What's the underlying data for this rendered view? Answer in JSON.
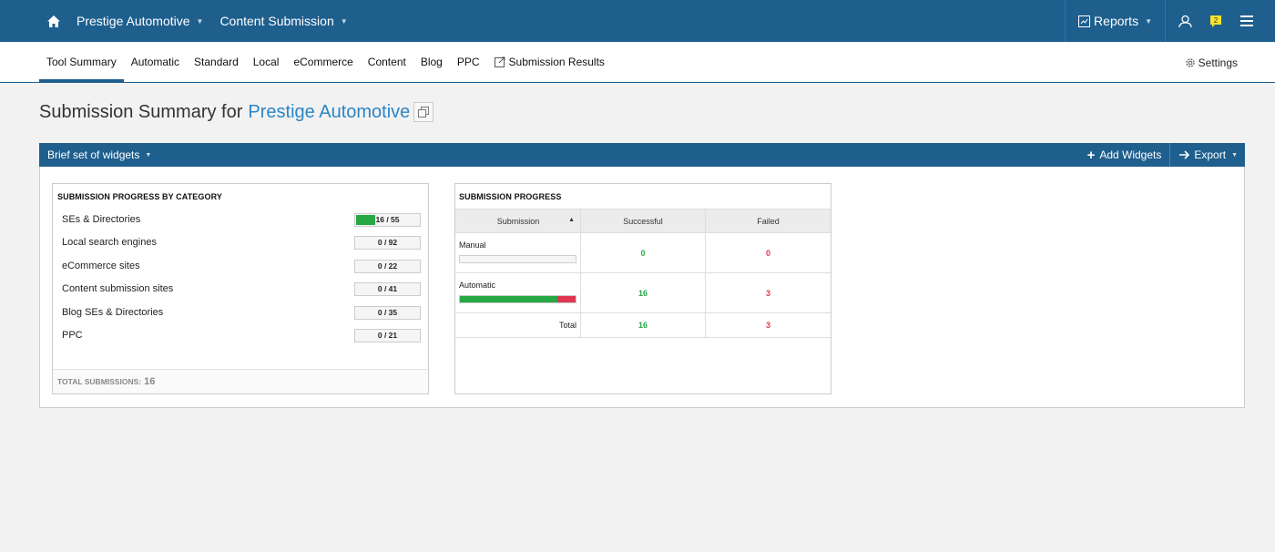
{
  "topbar": {
    "project": "Prestige Automotive",
    "module": "Content Submission",
    "reports": "Reports",
    "notification_count": "2"
  },
  "tabs": [
    {
      "label": "Tool Summary",
      "active": true
    },
    {
      "label": "Automatic"
    },
    {
      "label": "Standard"
    },
    {
      "label": "Local"
    },
    {
      "label": "eCommerce"
    },
    {
      "label": "Content"
    },
    {
      "label": "Blog"
    },
    {
      "label": "PPC"
    },
    {
      "label": "Submission Results"
    }
  ],
  "settings_label": "Settings",
  "page": {
    "title_prefix": "Submission Summary for",
    "project_name": "Prestige Automotive"
  },
  "widgetbar": {
    "set_label": "Brief set of widgets",
    "add_label": "Add Widgets",
    "export_label": "Export"
  },
  "category_widget": {
    "title": "SUBMISSION PROGRESS BY CATEGORY",
    "rows": [
      {
        "label": "SEs & Directories",
        "value": "16 / 55",
        "done": 16,
        "total": 55
      },
      {
        "label": "Local search engines",
        "value": "0 / 92",
        "done": 0,
        "total": 92
      },
      {
        "label": "eCommerce sites",
        "value": "0 / 22",
        "done": 0,
        "total": 22
      },
      {
        "label": "Content submission sites",
        "value": "0 / 41",
        "done": 0,
        "total": 41
      },
      {
        "label": "Blog SEs & Directories",
        "value": "0 / 35",
        "done": 0,
        "total": 35
      },
      {
        "label": "PPC",
        "value": "0 / 21",
        "done": 0,
        "total": 21
      }
    ],
    "footer_label": "TOTAL SUBMISSIONS:",
    "footer_value": "16"
  },
  "progress_widget": {
    "title": "SUBMISSION PROGRESS",
    "columns": [
      "Submission",
      "Successful",
      "Failed"
    ],
    "rows": [
      {
        "name": "Manual",
        "successful": "0",
        "failed": "0",
        "green_fraction": 0,
        "red_fraction": 0
      },
      {
        "name": "Automatic",
        "successful": "16",
        "failed": "3",
        "green_fraction": 0.84,
        "red_fraction": 0.16
      }
    ],
    "total_label": "Total",
    "total_successful": "16",
    "total_failed": "3"
  },
  "colors": {
    "brand": "#1e5f8e",
    "link": "#2a86c6",
    "success": "#28a745",
    "failed": "#e0364f"
  }
}
